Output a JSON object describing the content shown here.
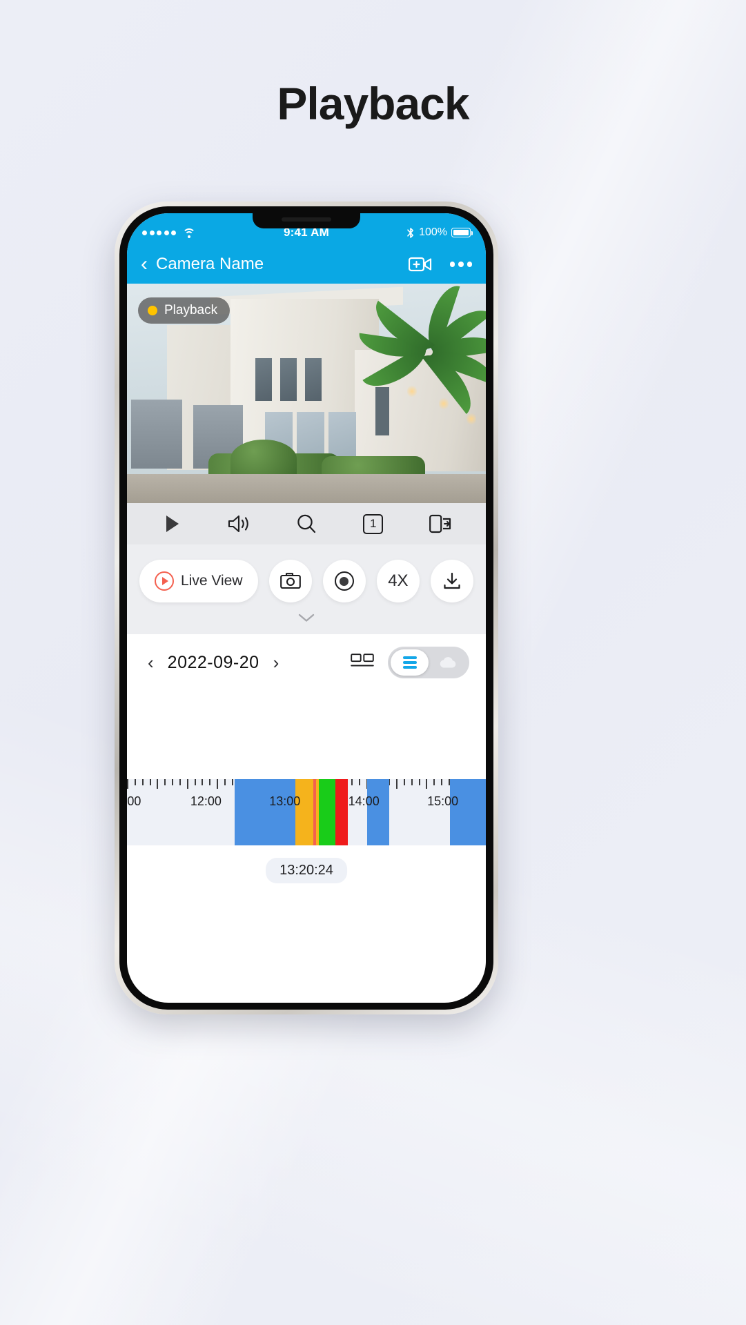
{
  "page": {
    "heading": "Playback"
  },
  "status_bar": {
    "signal_icon": "signal-dots-icon",
    "wifi_icon": "wifi-icon",
    "time": "9:41 AM",
    "bluetooth_icon": "bluetooth-icon",
    "battery_percent": "100%",
    "battery_icon": "battery-full-icon"
  },
  "nav_bar": {
    "back_icon": "chevron-left-icon",
    "title": "Camera Name",
    "add_camera_icon": "add-video-icon",
    "more_icon": "more-dots-icon",
    "background_color": "#0aa8e4"
  },
  "video": {
    "badge_label": "Playback",
    "badge_dot_color": "#ffc400",
    "badge_dot_icon": "status-dot-icon"
  },
  "toolbar": {
    "items": [
      {
        "name": "play-icon",
        "label": ""
      },
      {
        "name": "volume-icon",
        "label": ""
      },
      {
        "name": "search-icon",
        "label": ""
      },
      {
        "name": "channel-count-icon",
        "label": "1"
      },
      {
        "name": "pip-icon",
        "label": ""
      }
    ]
  },
  "actions": {
    "live_view_label": "Live View",
    "live_view_icon": "play-circle-icon",
    "snapshot_icon": "camera-icon",
    "record_icon": "record-icon",
    "speed_label": "4X",
    "download_icon": "download-icon",
    "collapse_icon": "chevron-down-icon"
  },
  "date_bar": {
    "prev_icon": "chevron-left-icon",
    "date": "2022-09-20",
    "next_icon": "chevron-right-icon",
    "split_view_icon": "split-view-icon",
    "toggle": {
      "selected": "device-storage",
      "device_icon": "device-storage-icon",
      "cloud_icon": "cloud-storage-icon"
    }
  },
  "timeline": {
    "hour_labels": [
      "00",
      "12:00",
      "13:00",
      "14:00",
      "15:00"
    ],
    "hour_label_positions": [
      2,
      22,
      44,
      66,
      88
    ],
    "playhead_position_percent": 52,
    "current_time": "13:20:24",
    "segments": [
      {
        "type": "recording",
        "color": "#4a90e2",
        "start_percent": 30,
        "width_percent": 17
      },
      {
        "type": "event-yellow",
        "color": "#f5b31c",
        "start_percent": 47,
        "width_percent": 6.5
      },
      {
        "type": "event-green",
        "color": "#19cc19",
        "start_percent": 53.5,
        "width_percent": 4.5
      },
      {
        "type": "event-red",
        "color": "#ef1b1b",
        "start_percent": 58,
        "width_percent": 3.5
      },
      {
        "type": "recording",
        "color": "#4a90e2",
        "start_percent": 67,
        "width_percent": 6
      },
      {
        "type": "recording",
        "color": "#4a90e2",
        "start_percent": 90,
        "width_percent": 10
      }
    ],
    "colors": {
      "recording": "#4a90e2",
      "track_background": "#eef1f7",
      "playhead": "#f4604f"
    }
  }
}
